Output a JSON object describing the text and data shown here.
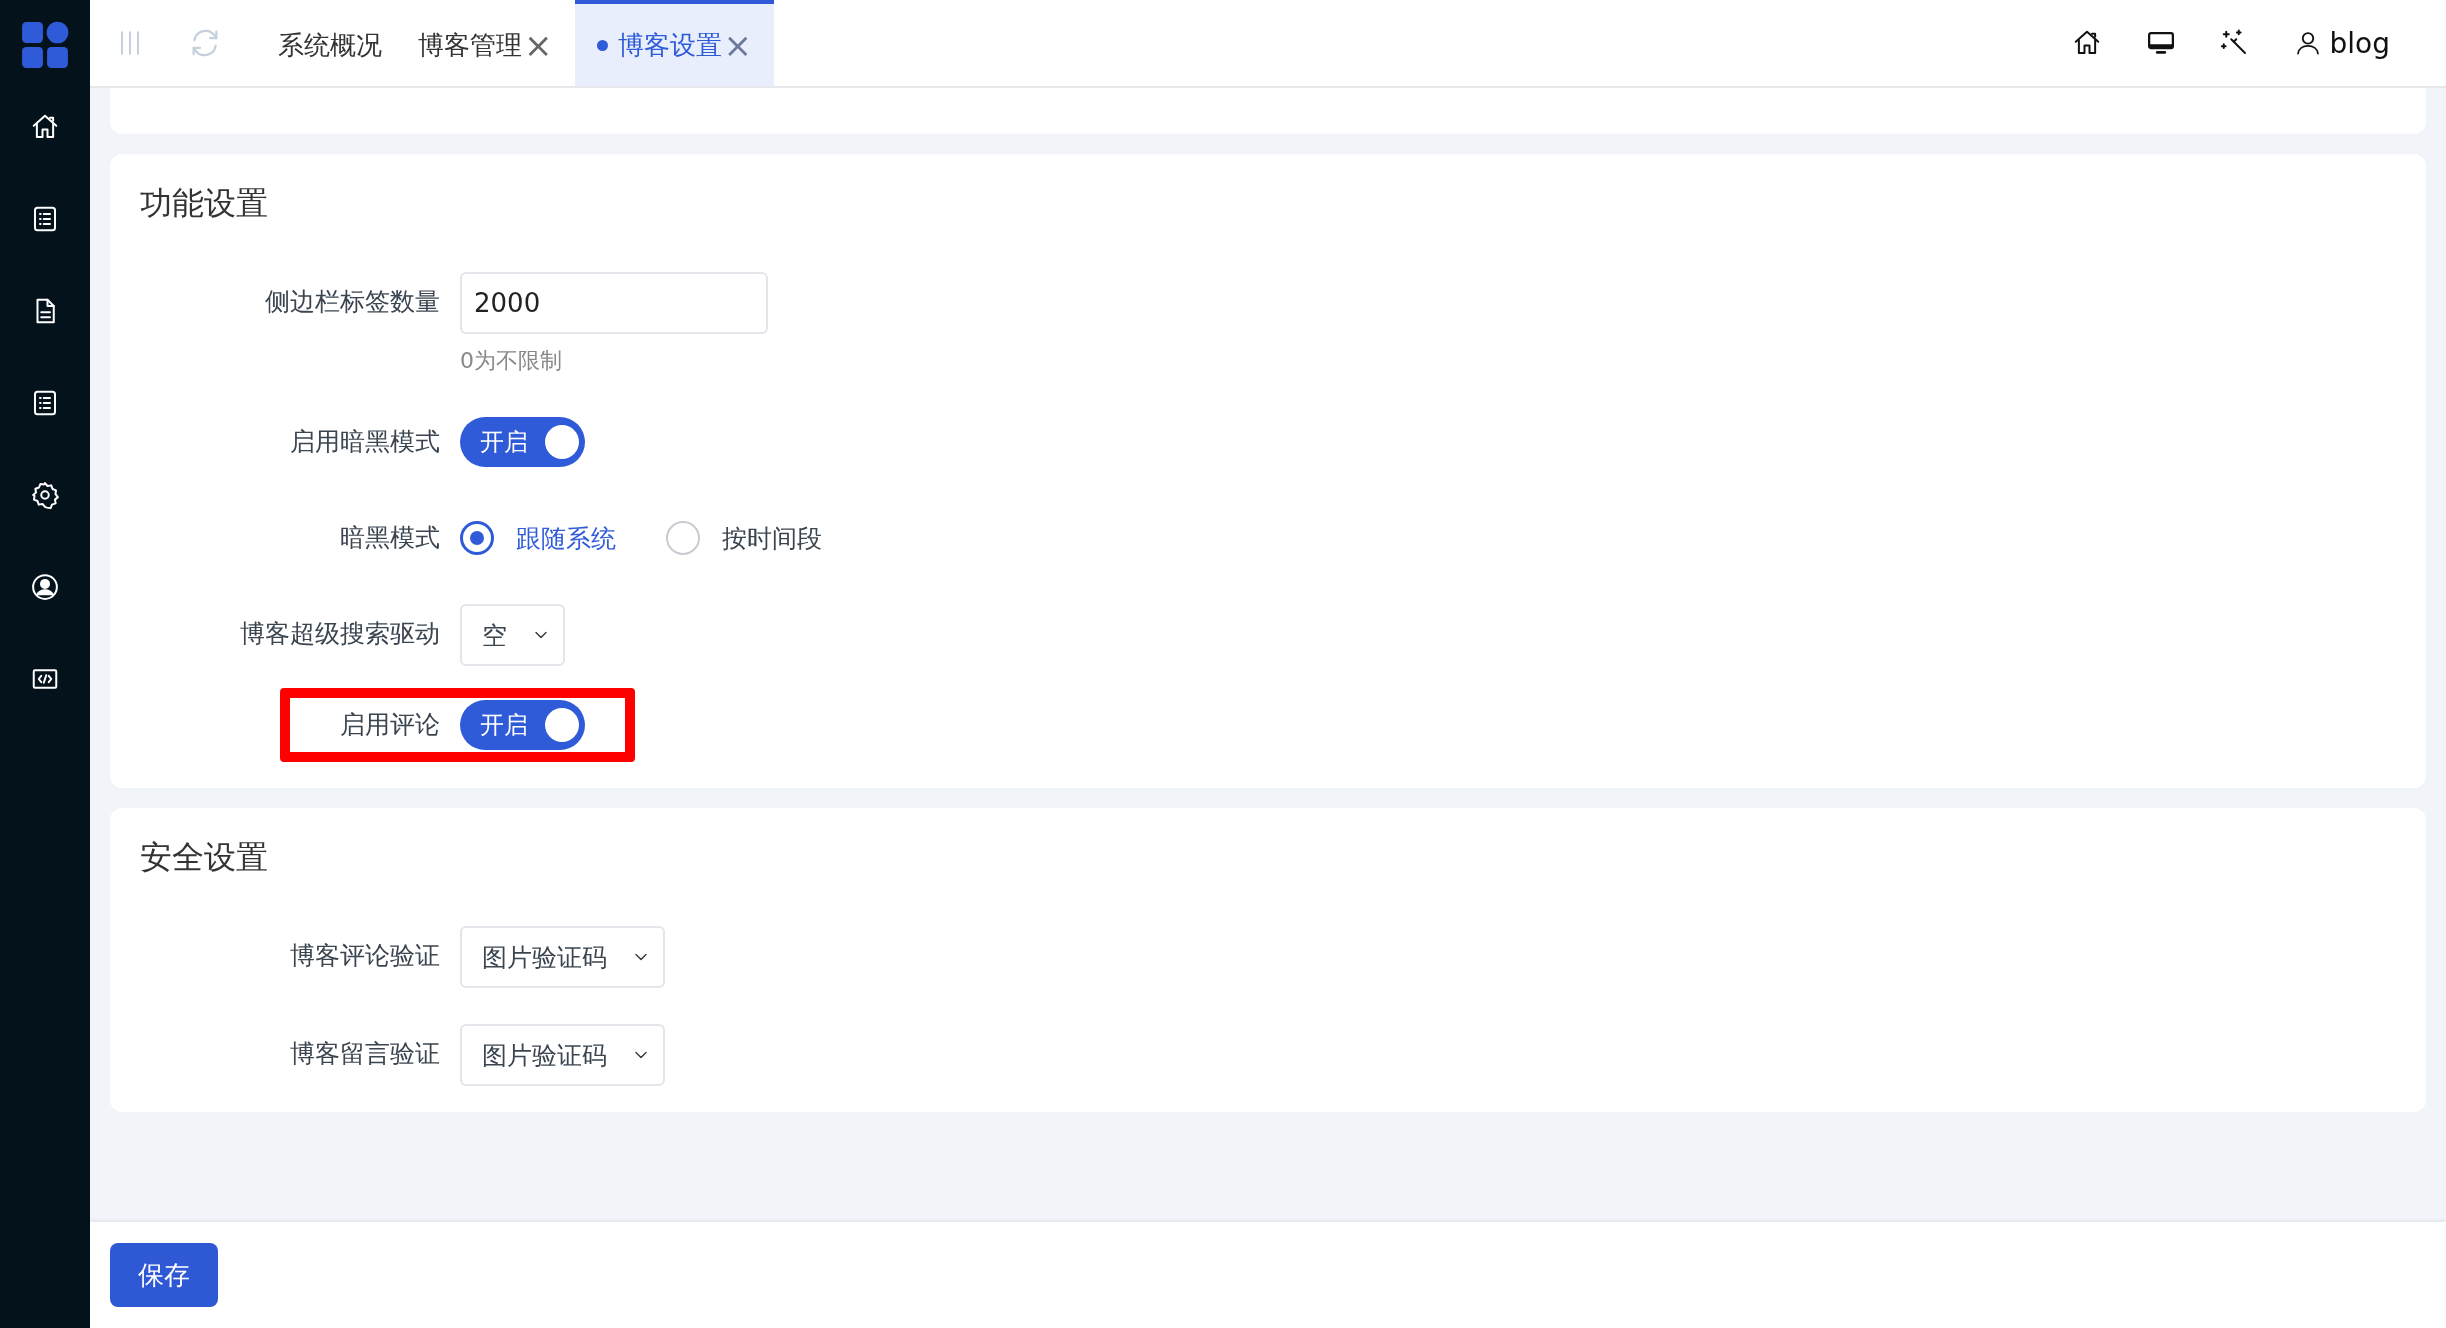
{
  "tabs": [
    {
      "label": "系统概况",
      "selected": false,
      "closable": false
    },
    {
      "label": "博客管理",
      "selected": false,
      "closable": true
    },
    {
      "label": "博客设置",
      "selected": true,
      "closable": true
    }
  ],
  "close_glyph": "×",
  "user": {
    "name": "blog"
  },
  "sections": [
    {
      "title": "功能设置",
      "fields": [
        {
          "kind": "input",
          "label": "侧边栏标签数量",
          "value": "2000",
          "hint": "0为不限制",
          "highlighted": false
        },
        {
          "kind": "switch",
          "label": "启用暗黑模式",
          "on": true,
          "text": "开启",
          "highlighted": false
        },
        {
          "kind": "radio",
          "label": "暗黑模式",
          "highlighted": false,
          "options": [
            {
              "label": "跟随系统",
              "selected": true
            },
            {
              "label": "按时间段",
              "selected": false
            }
          ]
        },
        {
          "kind": "select",
          "label": "博客超级搜索驱动",
          "value": "空",
          "highlighted": false
        },
        {
          "kind": "switch",
          "label": "启用评论",
          "on": true,
          "text": "开启",
          "highlighted": true
        }
      ]
    },
    {
      "title": "安全设置",
      "fields": [
        {
          "kind": "select",
          "label": "博客评论验证",
          "value": "图片验证码",
          "highlighted": false
        },
        {
          "kind": "select",
          "label": "博客留言验证",
          "value": "图片验证码",
          "highlighted": false
        }
      ]
    }
  ],
  "save_button": "保存"
}
